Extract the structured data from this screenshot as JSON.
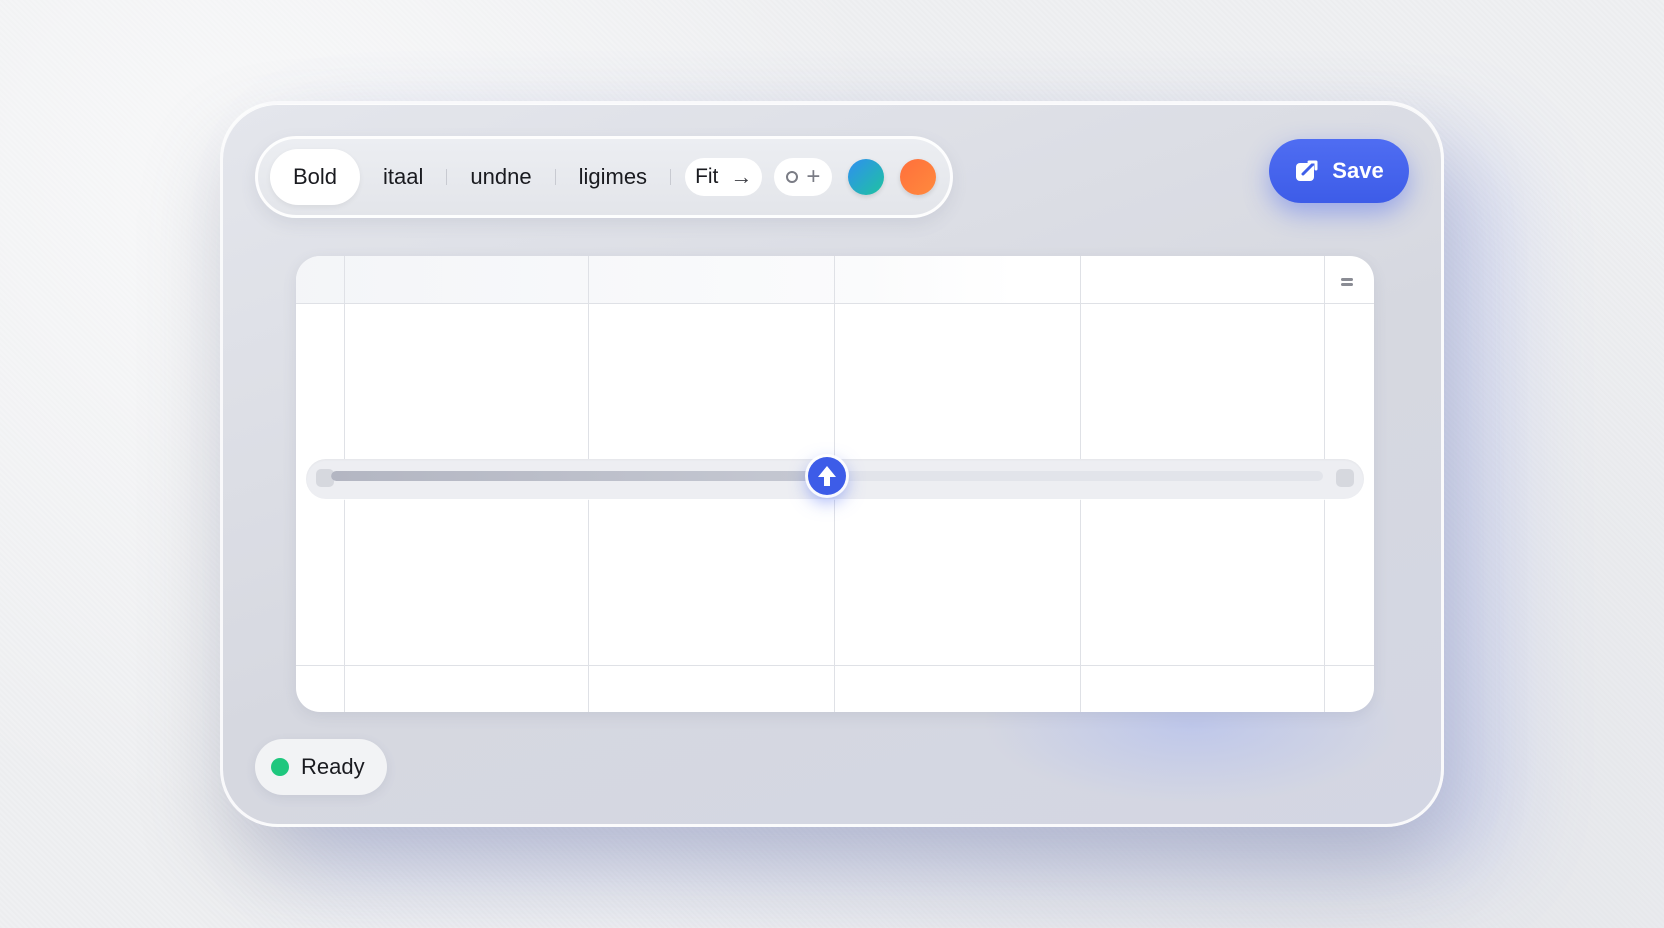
{
  "toolbar": {
    "formats": [
      {
        "label": "Bold",
        "active": true
      },
      {
        "label": "itaal",
        "active": false
      },
      {
        "label": "undne",
        "active": false
      },
      {
        "label": "ligimes",
        "active": false
      }
    ],
    "font_pill": {
      "label": "Fit",
      "icon": "arrow-right-icon"
    },
    "add_pill": {
      "icons": [
        "circle-icon",
        "plus-icon"
      ]
    },
    "swatches": [
      {
        "name": "teal-blue",
        "colors": [
          "#2f8ff0",
          "#1fc3a0"
        ]
      },
      {
        "name": "orange",
        "colors": [
          "#ff6f3c",
          "#ff8a3d"
        ]
      }
    ]
  },
  "save": {
    "label": "Save",
    "icon": "edit-icon",
    "color": "#3f5fe9"
  },
  "grid": {
    "columns": 5,
    "rows": 3,
    "handle_icon": "drag-handle-icon"
  },
  "slider": {
    "value": 0.5,
    "knob_icon": "arrow-up-icon",
    "accent": "#3d5ce8"
  },
  "status": {
    "label": "Ready",
    "color": "#1fc77e"
  }
}
